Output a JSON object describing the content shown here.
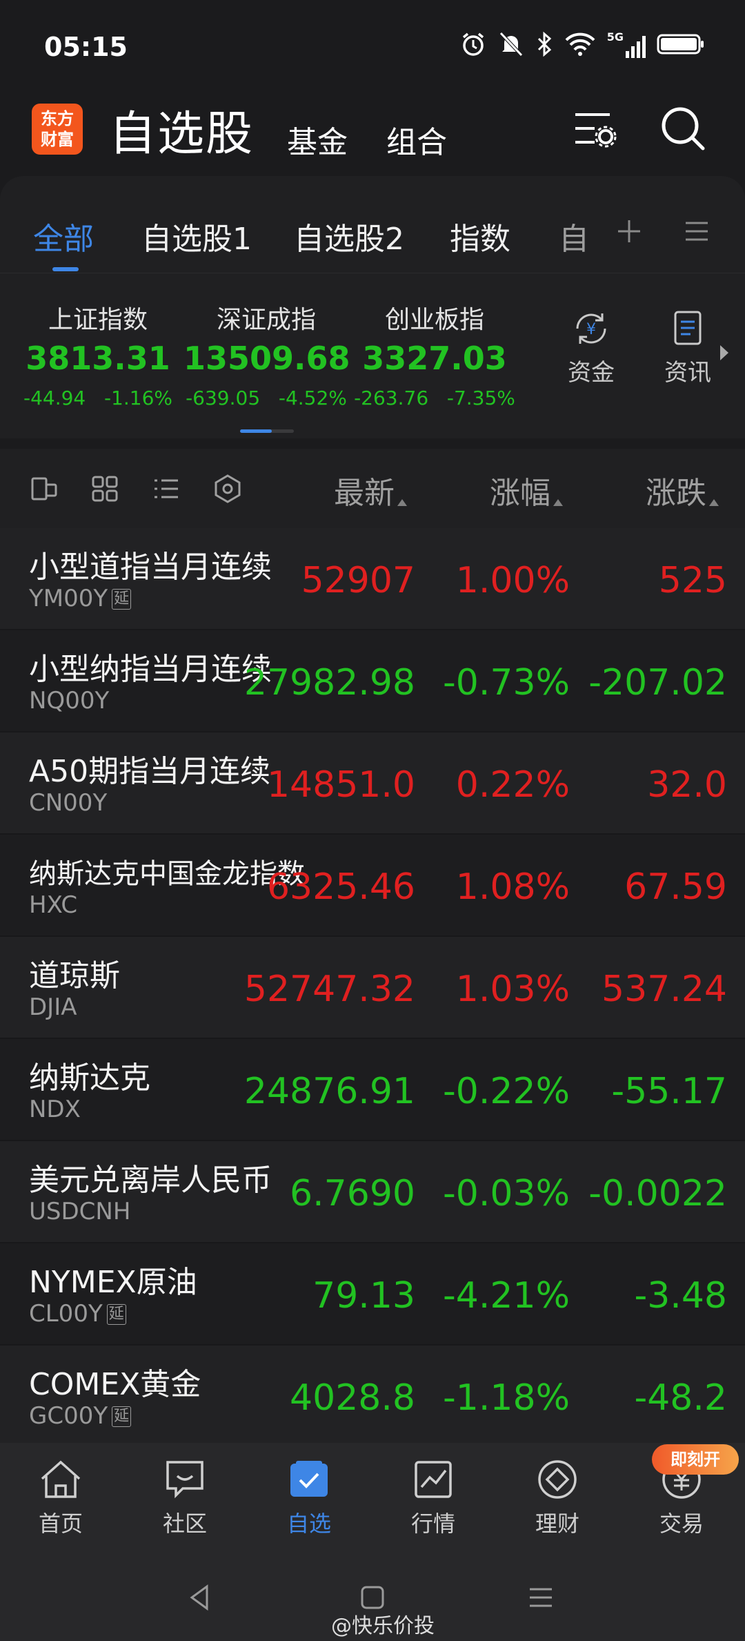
{
  "status_bar": {
    "time": "05:15",
    "network": "5G"
  },
  "header": {
    "logo_text": "东方财富",
    "logo_line1": "东方",
    "logo_line2": "财富",
    "title": "自选股",
    "tabs": [
      "基金",
      "组合"
    ]
  },
  "watch_tabs": [
    "全部",
    "自选股1",
    "自选股2",
    "指数",
    "自"
  ],
  "indices": [
    {
      "name": "上证指数",
      "value": "3813.31",
      "change": "-44.94",
      "pct": "-1.16%"
    },
    {
      "name": "深证成指",
      "value": "13509.68",
      "change": "-639.05",
      "pct": "-4.52%"
    },
    {
      "name": "创业板指",
      "value": "3327.03",
      "change": "-263.76",
      "pct": "-7.35%"
    }
  ],
  "index_actions": [
    "资金",
    "资讯"
  ],
  "columns": {
    "latest": "最新",
    "change_pct": "涨幅",
    "change": "涨跌"
  },
  "rows": [
    {
      "name": "小型道指当月连续",
      "code": "YM00Y",
      "delayed": true,
      "latest": "52907",
      "pct": "1.00%",
      "chg": "525",
      "dir": "up"
    },
    {
      "name": "小型纳指当月连续",
      "code": "NQ00Y",
      "delayed": false,
      "latest": "27982.98",
      "pct": "-0.73%",
      "chg": "-207.02",
      "dir": "dn"
    },
    {
      "name": "A50期指当月连续",
      "code": "CN00Y",
      "delayed": false,
      "latest": "14851.0",
      "pct": "0.22%",
      "chg": "32.0",
      "dir": "up"
    },
    {
      "name": "纳斯达克中国金龙指数",
      "code": "HXC",
      "delayed": false,
      "latest": "6325.46",
      "pct": "1.08%",
      "chg": "67.59",
      "dir": "up"
    },
    {
      "name": "道琼斯",
      "code": "DJIA",
      "delayed": false,
      "latest": "52747.32",
      "pct": "1.03%",
      "chg": "537.24",
      "dir": "up"
    },
    {
      "name": "纳斯达克",
      "code": "NDX",
      "delayed": false,
      "latest": "24876.91",
      "pct": "-0.22%",
      "chg": "-55.17",
      "dir": "dn"
    },
    {
      "name": "美元兑离岸人民币",
      "code": "USDCNH",
      "delayed": false,
      "latest": "6.7690",
      "pct": "-0.03%",
      "chg": "-0.0022",
      "dir": "dn"
    },
    {
      "name": "NYMEX原油",
      "code": "CL00Y",
      "delayed": true,
      "latest": "79.13",
      "pct": "-4.21%",
      "chg": "-3.48",
      "dir": "dn"
    },
    {
      "name": "COMEX黄金",
      "code": "GC00Y",
      "delayed": true,
      "latest": "4028.8",
      "pct": "-1.18%",
      "chg": "-48.2",
      "dir": "dn"
    }
  ],
  "delay_label": "延",
  "bottom_nav": [
    "首页",
    "社区",
    "自选",
    "行情",
    "理财",
    "交易"
  ],
  "badge": "即刻开",
  "watermark": "@快乐价投",
  "colors": {
    "up": "#e02020",
    "down": "#22c222",
    "accent": "#3e86e6",
    "brand": "#f3561d"
  }
}
